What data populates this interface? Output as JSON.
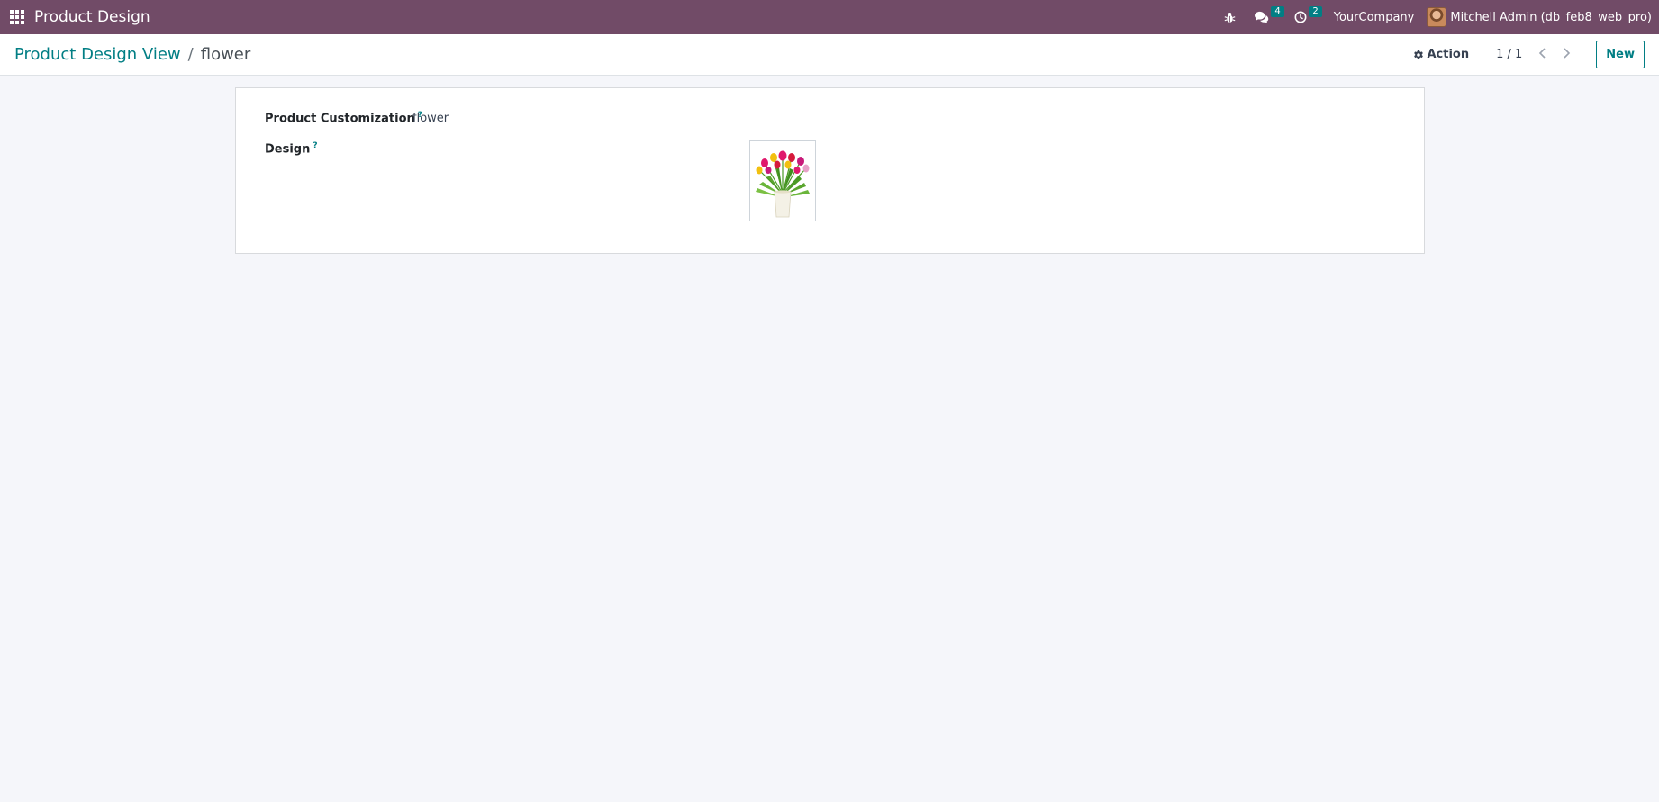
{
  "navbar": {
    "app_name": "Product Design",
    "messages_count": "4",
    "activities_count": "2",
    "company": "YourCompany",
    "user": "Mitchell Admin (db_feb8_web_pro)",
    "bg_color": "#714b67",
    "badge_color": "#017e84"
  },
  "breadcrumb": {
    "parent": "Product Design View",
    "separator": "/",
    "current": "flower"
  },
  "control": {
    "action_label": "Action",
    "pager_value": "1 / 1",
    "new_label": "New"
  },
  "form": {
    "customization_label": "Product Customization",
    "customization_help": "?",
    "customization_value": "flower",
    "design_label": "Design",
    "design_help": "?"
  },
  "icons": {
    "apps": "apps-grid-icon",
    "debug": "bug-icon",
    "messages": "comments-icon",
    "activities": "clock-icon",
    "action": "gear-icon",
    "prev": "chevron-left-icon",
    "next": "chevron-right-icon"
  }
}
